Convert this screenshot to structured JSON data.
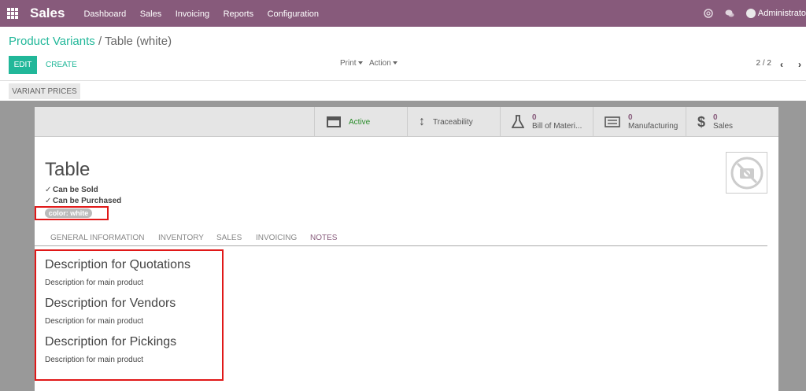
{
  "topbar": {
    "app_name": "Sales",
    "menu": [
      "Dashboard",
      "Sales",
      "Invoicing",
      "Reports",
      "Configuration"
    ],
    "user": "Administrato",
    "icons": [
      "apps-icon",
      "support-icon",
      "chat-icon",
      "avatar-icon"
    ]
  },
  "breadcrumb": {
    "parent": "Product Variants",
    "separator": "/",
    "current": "Table (white)"
  },
  "toolbar": {
    "edit": "EDIT",
    "create": "CREATE",
    "print": "Print",
    "action": "Action"
  },
  "pager": {
    "value": "2 / 2",
    "prev": "‹",
    "next": "›"
  },
  "variant_prices": "VARIANT PRICES",
  "smart_buttons": {
    "active": "Active",
    "traceability": "Traceability",
    "bom_count": "0",
    "bom_label": "Bill of Materi...",
    "mfg_count": "0",
    "mfg_label": "Manufacturing",
    "sales_count": "0",
    "sales_label": "Sales"
  },
  "product": {
    "name": "Table",
    "can_be_sold": "Can be Sold",
    "can_be_purchased": "Can be Purchased",
    "attribute_tag": "color: white"
  },
  "tabs": [
    "GENERAL INFORMATION",
    "INVENTORY",
    "SALES",
    "INVOICING",
    "NOTES"
  ],
  "active_tab": "NOTES",
  "notes": {
    "quotations_heading": "Description for Quotations",
    "quotations_text": "Description for main product",
    "vendors_heading": "Description for Vendors",
    "vendors_text": "Description for main product",
    "pickings_heading": "Description for Pickings",
    "pickings_text": "Description for main product"
  },
  "colors": {
    "brand": "#875a7b",
    "accent": "#21b799",
    "highlight": "#e01818"
  }
}
